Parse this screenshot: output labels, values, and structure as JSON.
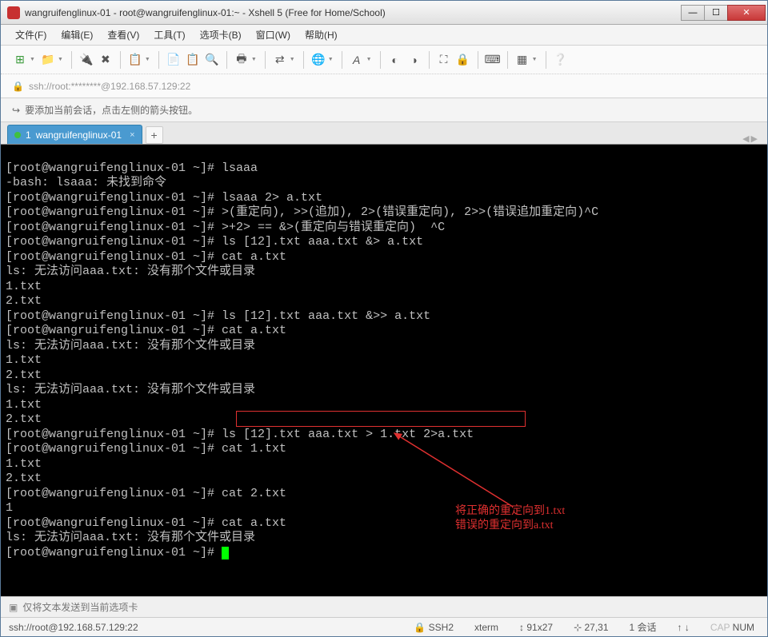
{
  "titlebar": {
    "title": "wangruifenglinux-01 - root@wangruifenglinux-01:~ - Xshell 5 (Free for Home/School)"
  },
  "menu": {
    "file": "文件(F)",
    "edit": "编辑(E)",
    "view": "查看(V)",
    "tools": "工具(T)",
    "tabs": "选项卡(B)",
    "window": "窗口(W)",
    "help": "帮助(H)"
  },
  "addressbar": {
    "url": "ssh://root:********@192.168.57.129:22"
  },
  "tipbar": {
    "text": "要添加当前会话，点击左侧的箭头按钮。"
  },
  "tab": {
    "index": "1",
    "name": "wangruifenglinux-01"
  },
  "terminal": {
    "lines": [
      "[root@wangruifenglinux-01 ~]# lsaaa",
      "-bash: lsaaa: 未找到命令",
      "[root@wangruifenglinux-01 ~]# lsaaa 2> a.txt",
      "[root@wangruifenglinux-01 ~]# >(重定向), >>(追加), 2>(错误重定向), 2>>(错误追加重定向)^C",
      "[root@wangruifenglinux-01 ~]# >+2> == &>(重定向与错误重定向)  ^C",
      "[root@wangruifenglinux-01 ~]# ls [12].txt aaa.txt &> a.txt",
      "[root@wangruifenglinux-01 ~]# cat a.txt",
      "ls: 无法访问aaa.txt: 没有那个文件或目录",
      "1.txt",
      "2.txt",
      "[root@wangruifenglinux-01 ~]# ls [12].txt aaa.txt &>> a.txt",
      "[root@wangruifenglinux-01 ~]# cat a.txt",
      "ls: 无法访问aaa.txt: 没有那个文件或目录",
      "1.txt",
      "2.txt",
      "ls: 无法访问aaa.txt: 没有那个文件或目录",
      "1.txt",
      "2.txt",
      "[root@wangruifenglinux-01 ~]# ls [12].txt aaa.txt > 1.txt 2>a.txt",
      "[root@wangruifenglinux-01 ~]# cat 1.txt",
      "1.txt",
      "2.txt",
      "[root@wangruifenglinux-01 ~]# cat 2.txt",
      "1",
      "[root@wangruifenglinux-01 ~]# cat a.txt",
      "ls: 无法访问aaa.txt: 没有那个文件或目录",
      "[root@wangruifenglinux-01 ~]# "
    ]
  },
  "annotation": {
    "line1": "将正确的重定向到1.txt",
    "line2": "错误的重定向到a.txt"
  },
  "sendbar": {
    "placeholder": "仅将文本发送到当前选项卡"
  },
  "statusbar": {
    "conn": "ssh://root@192.168.57.129:22",
    "ssh": "SSH2",
    "term": "xterm",
    "size": "91x27",
    "pos": "27,31",
    "sessions": "1 会话",
    "cap": "CAP",
    "num": "NUM"
  }
}
